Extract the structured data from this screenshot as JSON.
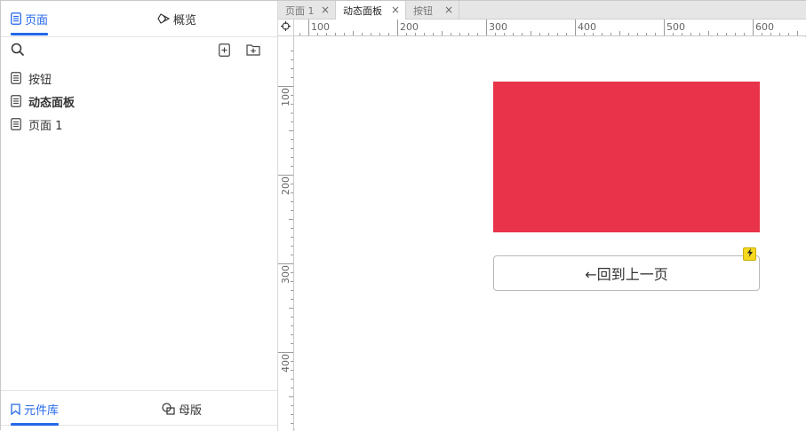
{
  "left_panel": {
    "top_tabs": [
      {
        "label": "页面",
        "icon": "page-icon",
        "active": true
      },
      {
        "label": "概览",
        "icon": "diamond-icon",
        "active": false
      }
    ],
    "pages": [
      {
        "label": "按钮",
        "icon": "page-icon",
        "current": false
      },
      {
        "label": "动态面板",
        "icon": "page-icon",
        "current": true
      },
      {
        "label": "页面 1",
        "icon": "page-icon",
        "current": false
      }
    ],
    "bottom_tabs": [
      {
        "label": "元件库",
        "icon": "bookmark-icon",
        "active": true
      },
      {
        "label": "母版",
        "icon": "overlap-icon",
        "active": false
      }
    ]
  },
  "doc_tabs": [
    {
      "label": "页面 1",
      "active": false
    },
    {
      "label": "动态面板",
      "active": true
    },
    {
      "label": "按钮",
      "active": false
    }
  ],
  "close_glyph": "×",
  "hruler_labels": [
    "100",
    "200",
    "300",
    "400",
    "500",
    "600"
  ],
  "vruler_labels": [
    "100",
    "200",
    "300",
    "400"
  ],
  "canvas": {
    "dynamic_panel_color": "#e8334a",
    "back_button_label": "←回到上一页"
  },
  "colors": {
    "accent": "#2468e8",
    "lightning_badge": "#f5d820"
  }
}
